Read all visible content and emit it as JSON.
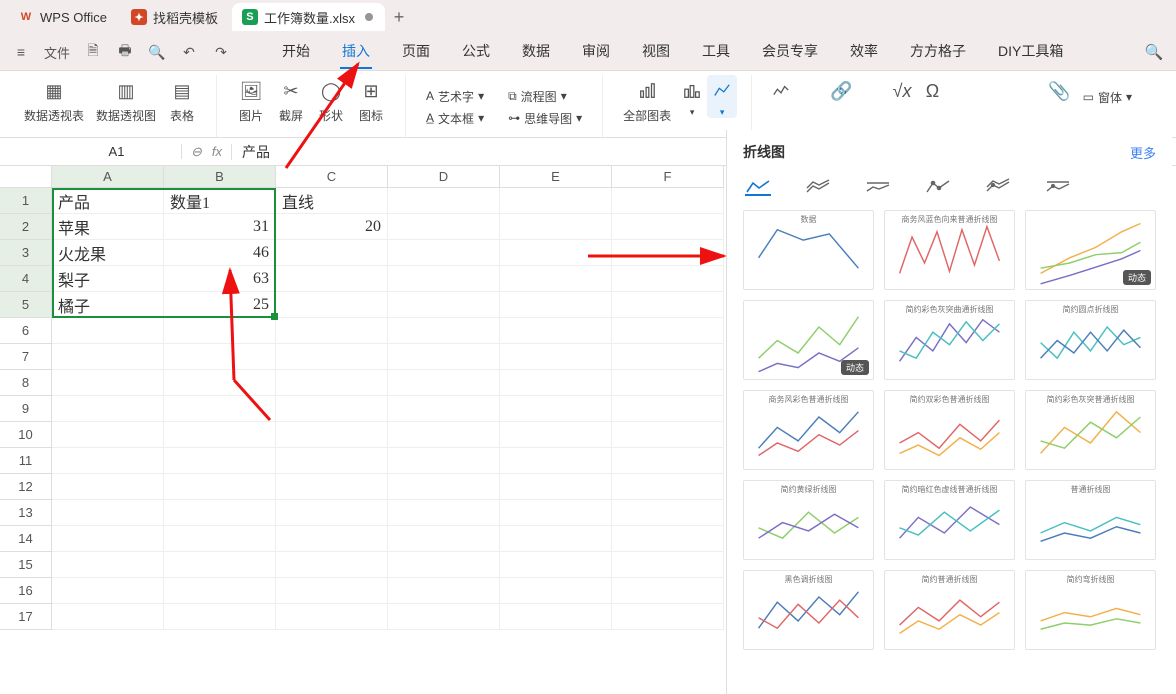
{
  "tabs": {
    "app": "WPS Office",
    "search": "找稻壳模板",
    "doc": "工作簿数量.xlsx"
  },
  "menu": {
    "file": "文件",
    "items": [
      "开始",
      "插入",
      "页面",
      "公式",
      "数据",
      "审阅",
      "视图",
      "工具",
      "会员专享",
      "效率",
      "方方格子",
      "DIY工具箱"
    ],
    "active_index": 1
  },
  "ribbon": {
    "grp_data": [
      "数据透视表",
      "数据透视图",
      "表格"
    ],
    "grp_ill": [
      "图片",
      "截屏",
      "形状",
      "图标"
    ],
    "grp_txt": [
      "艺术字",
      "文本框",
      "流程图",
      "思维导图"
    ],
    "grp_cht": [
      "全部图表"
    ],
    "grp_sym": [
      "窗体"
    ]
  },
  "formula_bar": {
    "cell_ref": "A1",
    "value": "产品"
  },
  "sheet": {
    "columns": [
      "A",
      "B",
      "C",
      "D",
      "E",
      "F"
    ],
    "rows": 17,
    "selected_rows": [
      1,
      2,
      3,
      4,
      5
    ],
    "selected_cols": [
      0,
      1
    ],
    "cells": {
      "A1": "产品",
      "B1": "数量1",
      "C1": "直线",
      "A2": "苹果",
      "B2": "31",
      "C2": "20",
      "A3": "火龙果",
      "B3": "46",
      "A4": "梨子",
      "B4": "63",
      "A5": "橘子",
      "B5": "25"
    }
  },
  "panel": {
    "title": "折线图",
    "more": "更多",
    "badge": "动态",
    "thumb_titles": [
      "数据",
      "商务风蓝色向来普通折线图",
      "",
      "",
      "简约彩色灰突曲通折线图",
      "简约圆点折线图",
      "商务风彩色普通折线图",
      "简约双彩色普通折线图",
      "简约彩色灰突普通折线图",
      "简约黄绿折线图",
      "简约暗红色虚线普通折线图",
      "普通折线图",
      "黑色调折线图",
      "简约普通折线图",
      "简约弯折线图"
    ]
  },
  "chart_data": {
    "type": "line",
    "title": "数量1",
    "categories": [
      "苹果",
      "火龙果",
      "梨子",
      "橘子"
    ],
    "values": [
      31,
      46,
      63,
      25
    ],
    "xlabel": "产品",
    "ylabel": "数量1"
  }
}
